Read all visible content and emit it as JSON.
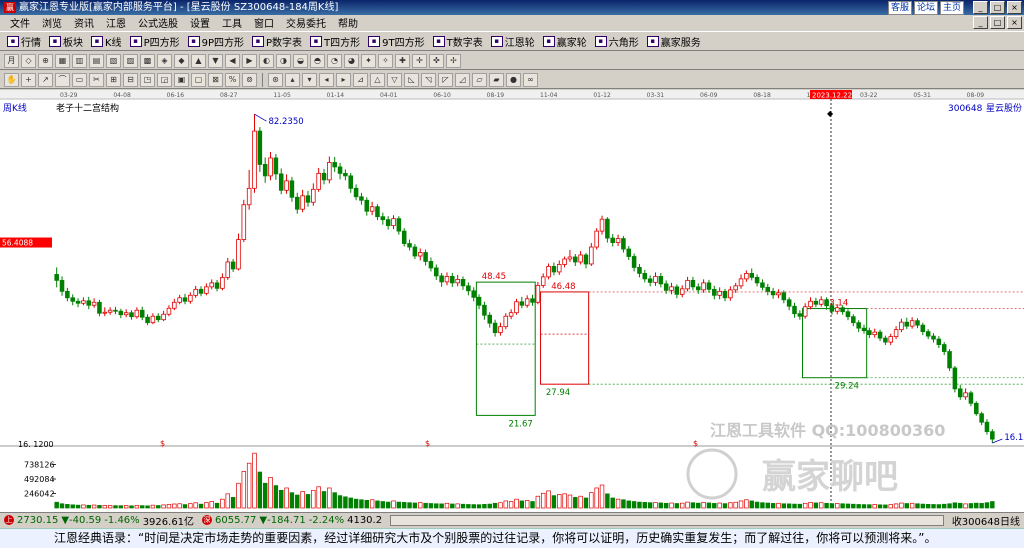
{
  "window": {
    "title": "赢家江恩专业版[赢家内部服务平台] - [星云股份  SZ300648-184周K线]",
    "title_links": [
      "客服",
      "论坛",
      "主页"
    ],
    "win_min": "_",
    "win_max": "□",
    "win_close": "×"
  },
  "menu": [
    "文件",
    "浏览",
    "资讯",
    "江恩",
    "公式选股",
    "设置",
    "工具",
    "窗口",
    "交易委托",
    "帮助"
  ],
  "toolbar1": [
    {
      "label": "行情",
      "icon": "grid-icon"
    },
    {
      "label": "板块",
      "icon": "blocks-icon"
    },
    {
      "label": "K线",
      "icon": "kline-icon"
    },
    {
      "label": "P四方形",
      "icon": "p-square-icon"
    },
    {
      "label": "9P四方形",
      "icon": "9p-square-icon"
    },
    {
      "label": "P数字表",
      "icon": "p-table-icon"
    },
    {
      "label": "T四方形",
      "icon": "t-square-icon"
    },
    {
      "label": "9T四方形",
      "icon": "9t-square-icon"
    },
    {
      "label": "T数字表",
      "icon": "t-table-icon"
    },
    {
      "label": "江恩轮",
      "icon": "gann-wheel-icon"
    },
    {
      "label": "赢家轮",
      "icon": "winner-wheel-icon"
    },
    {
      "label": "六角形",
      "icon": "hexagon-icon"
    },
    {
      "label": "赢家服务",
      "icon": "service-icon"
    }
  ],
  "toolbar2": {
    "period": "月"
  },
  "chart_data": {
    "type": "candlestick",
    "panel_label": "周K线",
    "indicator_label": "老子十二宫结构",
    "stock_code": "300648",
    "stock_name": "星云股份",
    "date_ticks": [
      "03-29",
      "04-08",
      "06-16",
      "08-27",
      "11-05",
      "01-14",
      "04-01",
      "06-10",
      "08-19",
      "11-04",
      "01-12",
      "03-31",
      "06-09",
      "08-18",
      "11-03",
      "03-22",
      "05-31",
      "08-09"
    ],
    "cursor_date": "2023.12.22",
    "cursor_price": "56.4088",
    "ylim": [
      16.12,
      82.235
    ],
    "high_label": "82.2350",
    "low_label": "16.1200",
    "low_axis_label": "16. 1200",
    "box_labels": [
      "48.45",
      "46.48",
      "27.94",
      "21.67",
      "43.14",
      "29.24"
    ],
    "volume_ticks": [
      "738126",
      "492084",
      "246042"
    ],
    "vol_max": 984168,
    "dollar_marks": [
      "$",
      "$",
      "$"
    ],
    "colors": {
      "up": "#e00000",
      "down": "#008000",
      "text": "#000000",
      "label": "#0000c0",
      "cursor_box": "#ff0000"
    },
    "candles": [
      [
        50.0,
        48.8,
        51.4,
        47.4
      ],
      [
        48.8,
        46.6,
        49.6,
        45.7
      ],
      [
        46.6,
        45.3,
        47.3,
        44.6
      ],
      [
        45.3,
        44.6,
        46.0,
        43.8
      ],
      [
        44.6,
        44.2,
        45.2,
        43.4
      ],
      [
        44.2,
        44.7,
        45.4,
        43.8
      ],
      [
        44.7,
        43.8,
        45.5,
        43.0
      ],
      [
        43.8,
        44.4,
        45.2,
        43.3
      ],
      [
        44.4,
        42.2,
        44.9,
        41.6
      ],
      [
        42.2,
        42.4,
        43.4,
        41.6
      ],
      [
        42.4,
        42.8,
        43.4,
        41.9
      ],
      [
        42.8,
        42.6,
        43.5,
        42.0
      ],
      [
        42.6,
        41.9,
        43.1,
        41.2
      ],
      [
        41.9,
        42.3,
        43.0,
        41.4
      ],
      [
        42.3,
        41.5,
        42.8,
        40.9
      ],
      [
        41.5,
        42.8,
        43.4,
        41.1
      ],
      [
        42.8,
        41.4,
        43.5,
        40.8
      ],
      [
        41.4,
        40.3,
        42.0,
        39.8
      ],
      [
        40.3,
        41.6,
        42.2,
        40.0
      ],
      [
        41.6,
        40.9,
        42.2,
        40.4
      ],
      [
        40.9,
        42.0,
        42.7,
        40.6
      ],
      [
        42.0,
        43.2,
        43.8,
        41.6
      ],
      [
        43.2,
        44.4,
        45.1,
        42.8
      ],
      [
        44.4,
        45.3,
        45.9,
        44.0
      ],
      [
        45.3,
        44.6,
        46.1,
        44.0
      ],
      [
        44.6,
        45.8,
        46.4,
        44.1
      ],
      [
        45.8,
        47.0,
        47.7,
        45.3
      ],
      [
        47.0,
        46.2,
        47.6,
        45.6
      ],
      [
        46.2,
        47.5,
        48.2,
        45.8
      ],
      [
        47.5,
        48.3,
        49.0,
        47.0
      ],
      [
        48.3,
        47.2,
        48.9,
        46.6
      ],
      [
        47.2,
        49.4,
        50.2,
        46.8
      ],
      [
        49.4,
        52.5,
        53.3,
        48.9
      ],
      [
        52.5,
        51.1,
        53.1,
        50.5
      ],
      [
        51.1,
        57.0,
        58.2,
        50.8
      ],
      [
        57.0,
        64.0,
        65.0,
        56.5
      ],
      [
        64.0,
        67.3,
        71.0,
        63.0
      ],
      [
        67.3,
        78.8,
        82.2,
        66.4
      ],
      [
        78.8,
        72.1,
        79.6,
        70.6
      ],
      [
        72.1,
        69.8,
        73.5,
        68.4
      ],
      [
        69.8,
        73.4,
        74.6,
        68.9
      ],
      [
        73.4,
        70.2,
        74.2,
        69.0
      ],
      [
        70.2,
        66.9,
        71.3,
        66.1
      ],
      [
        66.9,
        68.8,
        70.1,
        66.2
      ],
      [
        68.8,
        65.5,
        69.6,
        64.6
      ],
      [
        65.5,
        63.1,
        66.4,
        62.2
      ],
      [
        63.1,
        65.8,
        67.0,
        62.5
      ],
      [
        65.8,
        64.5,
        66.8,
        63.6
      ],
      [
        64.5,
        67.1,
        68.3,
        63.8
      ],
      [
        67.1,
        70.3,
        71.4,
        66.6
      ],
      [
        70.3,
        69.0,
        71.2,
        68.1
      ],
      [
        69.0,
        72.5,
        73.7,
        68.3
      ],
      [
        72.5,
        71.6,
        73.6,
        70.6
      ],
      [
        71.6,
        70.3,
        72.4,
        69.1
      ],
      [
        70.3,
        69.8,
        71.1,
        68.9
      ],
      [
        69.8,
        67.3,
        70.4,
        66.4
      ],
      [
        67.3,
        65.6,
        68.1,
        64.9
      ],
      [
        65.6,
        64.9,
        66.4,
        64.0
      ],
      [
        64.9,
        62.7,
        65.5,
        61.8
      ],
      [
        62.7,
        63.6,
        64.6,
        61.9
      ],
      [
        63.6,
        61.6,
        64.1,
        60.9
      ],
      [
        61.6,
        61.0,
        62.4,
        60.0
      ],
      [
        61.0,
        59.8,
        61.7,
        59.0
      ],
      [
        59.8,
        61.2,
        61.9,
        59.1
      ],
      [
        61.2,
        58.7,
        61.7,
        58.0
      ],
      [
        58.7,
        56.2,
        59.3,
        55.6
      ],
      [
        56.2,
        55.5,
        57.0,
        54.8
      ],
      [
        55.5,
        53.7,
        56.1,
        53.1
      ],
      [
        53.7,
        54.4,
        55.2,
        52.8
      ],
      [
        54.4,
        52.6,
        55.0,
        51.8
      ],
      [
        52.6,
        51.3,
        53.4,
        50.6
      ],
      [
        51.3,
        49.7,
        52.0,
        48.9
      ],
      [
        49.7,
        48.5,
        50.3,
        47.5
      ],
      [
        48.5,
        49.6,
        50.4,
        47.8
      ],
      [
        49.6,
        48.3,
        50.3,
        47.5
      ],
      [
        48.3,
        49.0,
        49.9,
        47.6
      ],
      [
        49.0,
        47.7,
        49.6,
        46.9
      ],
      [
        47.7,
        46.7,
        48.4,
        45.8
      ],
      [
        46.7,
        45.4,
        47.4,
        44.6
      ],
      [
        45.4,
        43.8,
        46.0,
        43.0
      ],
      [
        43.8,
        41.8,
        44.5,
        40.9
      ],
      [
        41.8,
        40.2,
        42.4,
        39.3
      ],
      [
        40.2,
        38.3,
        40.9,
        37.5
      ],
      [
        38.3,
        39.5,
        40.3,
        37.7
      ],
      [
        39.5,
        41.6,
        42.2,
        39.0
      ],
      [
        41.6,
        42.3,
        43.0,
        41.0
      ],
      [
        42.3,
        44.5,
        45.1,
        41.9
      ],
      [
        44.5,
        43.8,
        45.5,
        43.2
      ],
      [
        43.8,
        45.1,
        45.8,
        43.3
      ],
      [
        45.1,
        44.4,
        45.9,
        43.7
      ],
      [
        44.4,
        47.8,
        48.5,
        44.0
      ],
      [
        47.8,
        49.5,
        50.2,
        47.3
      ],
      [
        49.5,
        51.6,
        52.2,
        49.0
      ],
      [
        51.6,
        50.5,
        52.4,
        49.8
      ],
      [
        50.5,
        52.0,
        52.8,
        49.9
      ],
      [
        52.0,
        53.1,
        53.6,
        51.4
      ],
      [
        53.1,
        53.5,
        54.9,
        52.5
      ],
      [
        53.5,
        52.5,
        54.1,
        51.7
      ],
      [
        52.5,
        53.9,
        54.7,
        52.0
      ],
      [
        53.9,
        52.1,
        54.3,
        51.2
      ],
      [
        52.1,
        55.5,
        56.3,
        51.7
      ],
      [
        55.5,
        58.7,
        59.3,
        55.0
      ],
      [
        58.7,
        61.1,
        61.8,
        58.0
      ],
      [
        61.1,
        57.3,
        61.5,
        56.4
      ],
      [
        57.3,
        56.4,
        58.1,
        55.6
      ],
      [
        56.4,
        57.2,
        58.0,
        55.7
      ],
      [
        57.2,
        55.1,
        57.7,
        54.4
      ],
      [
        55.1,
        53.6,
        55.7,
        52.9
      ],
      [
        53.6,
        51.4,
        54.2,
        50.6
      ],
      [
        51.4,
        50.2,
        52.1,
        49.4
      ],
      [
        50.2,
        49.1,
        50.9,
        48.4
      ],
      [
        49.1,
        48.4,
        49.8,
        47.6
      ],
      [
        48.4,
        49.6,
        50.4,
        47.7
      ],
      [
        49.6,
        48.1,
        50.3,
        47.4
      ],
      [
        48.1,
        46.8,
        48.8,
        46.1
      ],
      [
        46.8,
        47.5,
        48.3,
        46.0
      ],
      [
        47.5,
        46.0,
        48.0,
        45.2
      ],
      [
        46.0,
        47.1,
        47.8,
        45.4
      ],
      [
        47.1,
        48.8,
        49.5,
        46.6
      ],
      [
        48.8,
        47.5,
        49.5,
        46.8
      ],
      [
        47.5,
        46.9,
        48.2,
        46.1
      ],
      [
        46.9,
        48.3,
        49.0,
        46.3
      ],
      [
        48.3,
        47.0,
        48.9,
        46.3
      ],
      [
        47.0,
        45.8,
        47.7,
        45.0
      ],
      [
        45.8,
        46.6,
        47.4,
        45.0
      ],
      [
        46.6,
        45.3,
        47.1,
        44.6
      ],
      [
        45.3,
        46.9,
        47.6,
        44.7
      ],
      [
        46.9,
        47.7,
        48.3,
        46.3
      ],
      [
        47.7,
        49.1,
        50.0,
        47.1
      ],
      [
        49.1,
        50.2,
        50.8,
        48.5
      ],
      [
        50.2,
        49.4,
        51.2,
        48.8
      ],
      [
        49.4,
        48.3,
        50.0,
        47.6
      ],
      [
        48.3,
        47.4,
        49.0,
        46.8
      ],
      [
        47.4,
        46.6,
        48.1,
        45.8
      ],
      [
        46.6,
        45.9,
        47.3,
        45.1
      ],
      [
        45.9,
        46.3,
        47.0,
        45.2
      ],
      [
        46.3,
        44.9,
        46.8,
        44.2
      ],
      [
        44.9,
        43.6,
        45.4,
        42.8
      ],
      [
        43.6,
        42.1,
        44.3,
        41.3
      ],
      [
        42.1,
        41.6,
        42.8,
        40.9
      ],
      [
        41.6,
        43.5,
        44.2,
        41.1
      ],
      [
        43.5,
        44.6,
        45.4,
        43.0
      ],
      [
        44.6,
        44.0,
        45.3,
        43.4
      ],
      [
        44.0,
        44.9,
        45.6,
        43.5
      ],
      [
        44.9,
        43.7,
        45.4,
        42.9
      ],
      [
        43.7,
        42.6,
        44.3,
        41.9
      ],
      [
        42.6,
        43.3,
        44.0,
        42.0
      ],
      [
        43.3,
        42.5,
        43.8,
        41.9
      ],
      [
        42.5,
        41.5,
        43.0,
        40.8
      ],
      [
        41.5,
        40.3,
        42.0,
        39.6
      ],
      [
        40.3,
        39.2,
        40.8,
        38.4
      ],
      [
        39.2,
        38.7,
        39.9,
        38.1
      ],
      [
        38.7,
        37.9,
        39.3,
        37.2
      ],
      [
        37.9,
        38.4,
        39.1,
        37.3
      ],
      [
        38.4,
        37.2,
        38.9,
        36.6
      ],
      [
        37.2,
        36.4,
        37.7,
        35.8
      ],
      [
        36.4,
        37.5,
        38.1,
        35.8
      ],
      [
        37.5,
        38.9,
        39.6,
        37.0
      ],
      [
        38.9,
        40.4,
        41.1,
        38.4
      ],
      [
        40.4,
        39.6,
        41.3,
        39.0
      ],
      [
        39.6,
        40.7,
        41.4,
        39.1
      ],
      [
        40.7,
        39.8,
        41.2,
        39.2
      ],
      [
        39.8,
        38.5,
        40.3,
        37.8
      ],
      [
        38.5,
        37.6,
        39.0,
        37.0
      ],
      [
        37.6,
        37.0,
        38.2,
        36.3
      ],
      [
        37.0,
        35.9,
        37.6,
        35.2
      ],
      [
        35.9,
        34.5,
        36.4,
        33.8
      ],
      [
        34.5,
        31.2,
        35.0,
        30.6
      ],
      [
        31.2,
        27.0,
        31.6,
        26.3
      ],
      [
        27.0,
        25.4,
        27.8,
        24.8
      ],
      [
        25.4,
        26.2,
        27.1,
        24.8
      ],
      [
        26.2,
        24.1,
        26.6,
        23.5
      ],
      [
        24.1,
        22.0,
        24.5,
        21.6
      ],
      [
        22.0,
        20.3,
        22.4,
        19.7
      ],
      [
        20.3,
        18.4,
        20.9,
        17.8
      ],
      [
        18.4,
        16.9,
        18.9,
        16.12
      ]
    ],
    "volumes": [
      98000,
      72000,
      61000,
      54000,
      48000,
      52000,
      46000,
      50000,
      44000,
      41000,
      43000,
      40000,
      39000,
      42000,
      37000,
      45000,
      40000,
      36000,
      48000,
      42000,
      52000,
      60000,
      68000,
      72000,
      58000,
      74000,
      88000,
      65000,
      92000,
      110000,
      80000,
      150000,
      240000,
      180000,
      420000,
      620000,
      760000,
      930000,
      610000,
      420000,
      520000,
      380000,
      300000,
      340000,
      260000,
      220000,
      280000,
      230000,
      300000,
      360000,
      280000,
      340000,
      260000,
      210000,
      190000,
      170000,
      150000,
      140000,
      130000,
      140000,
      120000,
      110000,
      100000,
      120000,
      100000,
      95000,
      90000,
      85000,
      92000,
      80000,
      76000,
      72000,
      70000,
      80000,
      68000,
      70000,
      64000,
      60000,
      58000,
      56000,
      62000,
      66000,
      80000,
      90000,
      120000,
      110000,
      150000,
      120000,
      130000,
      110000,
      200000,
      250000,
      290000,
      210000,
      230000,
      240000,
      220000,
      180000,
      200000,
      170000,
      260000,
      340000,
      390000,
      240000,
      170000,
      150000,
      140000,
      120000,
      110000,
      100000,
      95000,
      90000,
      92000,
      86000,
      80000,
      84000,
      76000,
      82000,
      100000,
      90000,
      82000,
      95000,
      86000,
      78000,
      84000,
      74000,
      90000,
      98000,
      120000,
      140000,
      120000,
      100000,
      90000,
      84000,
      78000,
      80000,
      72000,
      70000,
      66000,
      64000,
      80000,
      95000,
      86000,
      90000,
      80000,
      74000,
      78000,
      72000,
      68000,
      64000,
      60000,
      58000,
      56000,
      60000,
      54000,
      52000,
      58000,
      70000,
      84000,
      76000,
      80000,
      72000,
      66000,
      62000,
      60000,
      58000,
      64000,
      72000,
      88000,
      80000,
      70000,
      76000,
      82000,
      78000,
      90000,
      110000
    ]
  },
  "status": {
    "sh_index": "2730.15",
    "sh_change": "▼-40.59",
    "sh_pct": "-1.46%",
    "sh_amount": "3926.61亿",
    "sz_index": "6055.77",
    "sz_change": "▼-184.71",
    "sz_pct": "-2.24%",
    "sz_amount": "4130.2",
    "right_text": "收300648日线"
  },
  "watermark": {
    "line1": "江恩工具软件  QQ:100800360",
    "line2": "赢家聊吧"
  },
  "footer": {
    "quote": "江恩经典语录：“时间是决定市场走势的重要因素，经过详细研究大市及个别股票的过往记录，你将可以证明，历史确实重复发生；而了解过往，你将可以预测将来。”。"
  }
}
